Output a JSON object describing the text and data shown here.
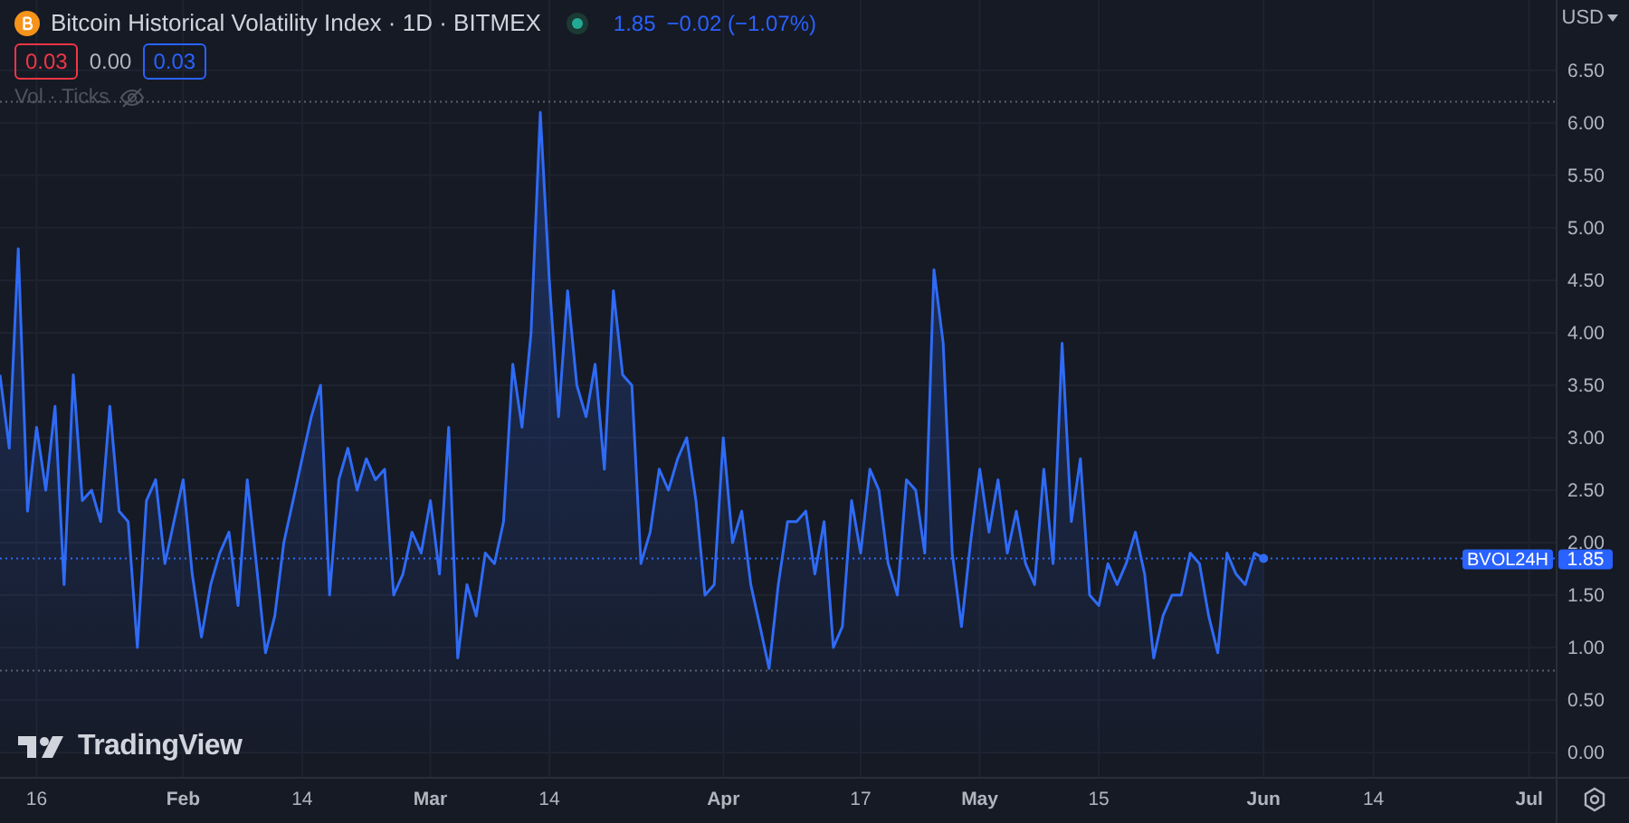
{
  "legend": {
    "title": "Bitcoin Historical Volatility Index · 1D · BITMEX",
    "last": "1.85",
    "change": "−0.02 (−1.07%)",
    "values": [
      {
        "text": "0.03",
        "kind": "boxed",
        "color": "#f23645"
      },
      {
        "text": "0.00",
        "kind": "plain",
        "color": "#b2b5be"
      },
      {
        "text": "0.03",
        "kind": "boxed",
        "color": "#2962ff"
      }
    ],
    "study": "Vol · Ticks"
  },
  "currency": "USD",
  "price_tag": {
    "value": "1.85"
  },
  "logo": "TradingView",
  "chart": {
    "chart_data": {
      "type": "area",
      "grid": true,
      "ylim": [
        -0.24,
        7.17
      ],
      "categories": [
        null,
        null,
        null,
        null,
        "16",
        null,
        null,
        null,
        null,
        null,
        null,
        null,
        null,
        null,
        null,
        null,
        null,
        null,
        null,
        null,
        "Feb",
        null,
        null,
        null,
        null,
        null,
        null,
        null,
        null,
        null,
        null,
        null,
        null,
        "14",
        null,
        null,
        null,
        null,
        null,
        null,
        null,
        null,
        null,
        null,
        null,
        null,
        null,
        "Mar",
        null,
        null,
        null,
        null,
        null,
        null,
        null,
        null,
        null,
        null,
        null,
        null,
        "14",
        null,
        null,
        null,
        null,
        null,
        null,
        null,
        null,
        null,
        null,
        null,
        null,
        null,
        null,
        null,
        null,
        null,
        null,
        "Apr",
        null,
        null,
        null,
        null,
        null,
        null,
        null,
        null,
        null,
        null,
        null,
        null,
        null,
        null,
        "17",
        null,
        null,
        null,
        null,
        null,
        null,
        null,
        null,
        null,
        null,
        null,
        null,
        "May",
        null,
        null,
        null,
        null,
        null,
        null,
        null,
        null,
        null,
        null,
        null,
        null,
        "15",
        null,
        null,
        null,
        null,
        null,
        null,
        null,
        null,
        null,
        null,
        null,
        null,
        null,
        null,
        null,
        null,
        null,
        "Jun",
        null,
        null,
        null,
        null,
        null,
        null,
        null,
        null,
        null,
        null,
        null,
        "14",
        null,
        null,
        null,
        null,
        null,
        null,
        null,
        null,
        null,
        null,
        null,
        null,
        null,
        null,
        null,
        null,
        "Jul",
        null,
        null
      ],
      "yticks": [
        {
          "value": 0,
          "label": "0.00"
        },
        {
          "value": 0.5,
          "label": "0.50"
        },
        {
          "value": 1,
          "label": "1.00"
        },
        {
          "value": 1.5,
          "label": "1.50"
        },
        {
          "value": 2,
          "label": "2.00"
        },
        {
          "value": 2.5,
          "label": "2.50"
        },
        {
          "value": 3,
          "label": "3.00"
        },
        {
          "value": 3.5,
          "label": "3.50"
        },
        {
          "value": 4,
          "label": "4.00"
        },
        {
          "value": 4.5,
          "label": "4.50"
        },
        {
          "value": 5,
          "label": "5.00"
        },
        {
          "value": 5.5,
          "label": "5.50"
        },
        {
          "value": 6,
          "label": "6.00"
        },
        {
          "value": 6.5,
          "label": "6.50"
        }
      ],
      "series": [
        {
          "name": "BVOL24H",
          "color": "#2f6bf5",
          "values": [
            3.6,
            2.9,
            4.8,
            2.3,
            3.1,
            2.5,
            3.3,
            1.6,
            3.6,
            2.4,
            2.5,
            2.2,
            3.3,
            2.3,
            2.2,
            1.0,
            2.4,
            2.6,
            1.8,
            2.2,
            2.6,
            1.7,
            1.1,
            1.6,
            1.9,
            2.1,
            1.4,
            2.6,
            1.8,
            0.95,
            1.3,
            2.0,
            2.4,
            2.8,
            3.2,
            3.5,
            1.5,
            2.6,
            2.9,
            2.5,
            2.8,
            2.6,
            2.7,
            1.5,
            1.7,
            2.1,
            1.9,
            2.4,
            1.7,
            3.1,
            0.9,
            1.6,
            1.3,
            1.9,
            1.8,
            2.2,
            3.7,
            3.1,
            4.0,
            6.1,
            4.5,
            3.2,
            4.4,
            3.5,
            3.2,
            3.7,
            2.7,
            4.4,
            3.6,
            3.5,
            1.8,
            2.1,
            2.7,
            2.5,
            2.8,
            3.0,
            2.4,
            1.5,
            1.6,
            3.0,
            2.0,
            2.3,
            1.6,
            1.2,
            0.8,
            1.6,
            2.2,
            2.2,
            2.3,
            1.7,
            2.2,
            1.0,
            1.2,
            2.4,
            1.9,
            2.7,
            2.5,
            1.8,
            1.5,
            2.6,
            2.5,
            1.9,
            4.6,
            3.9,
            1.9,
            1.2,
            2.0,
            2.7,
            2.1,
            2.6,
            1.9,
            2.3,
            1.8,
            1.6,
            2.7,
            1.8,
            3.9,
            2.2,
            2.8,
            1.5,
            1.4,
            1.8,
            1.6,
            1.8,
            2.1,
            1.7,
            0.9,
            1.3,
            1.5,
            1.5,
            1.9,
            1.8,
            1.3,
            0.95,
            1.9,
            1.7,
            1.6,
            1.9,
            1.85,
            null,
            null,
            null,
            null,
            null,
            null,
            null,
            null,
            null,
            null,
            null,
            null,
            null,
            null,
            null,
            null,
            null,
            null,
            null,
            null,
            null,
            null,
            null,
            null,
            null,
            null,
            null,
            null,
            null,
            null,
            null
          ]
        }
      ],
      "ref_lines": [
        {
          "axis": "y",
          "value": 6.2,
          "color": "#5d606b"
        },
        {
          "axis": "y",
          "value": 0.78,
          "color": "#5d606b"
        },
        {
          "axis": "y",
          "value": 1.85,
          "color": "#2f6bf5"
        }
      ]
    }
  }
}
